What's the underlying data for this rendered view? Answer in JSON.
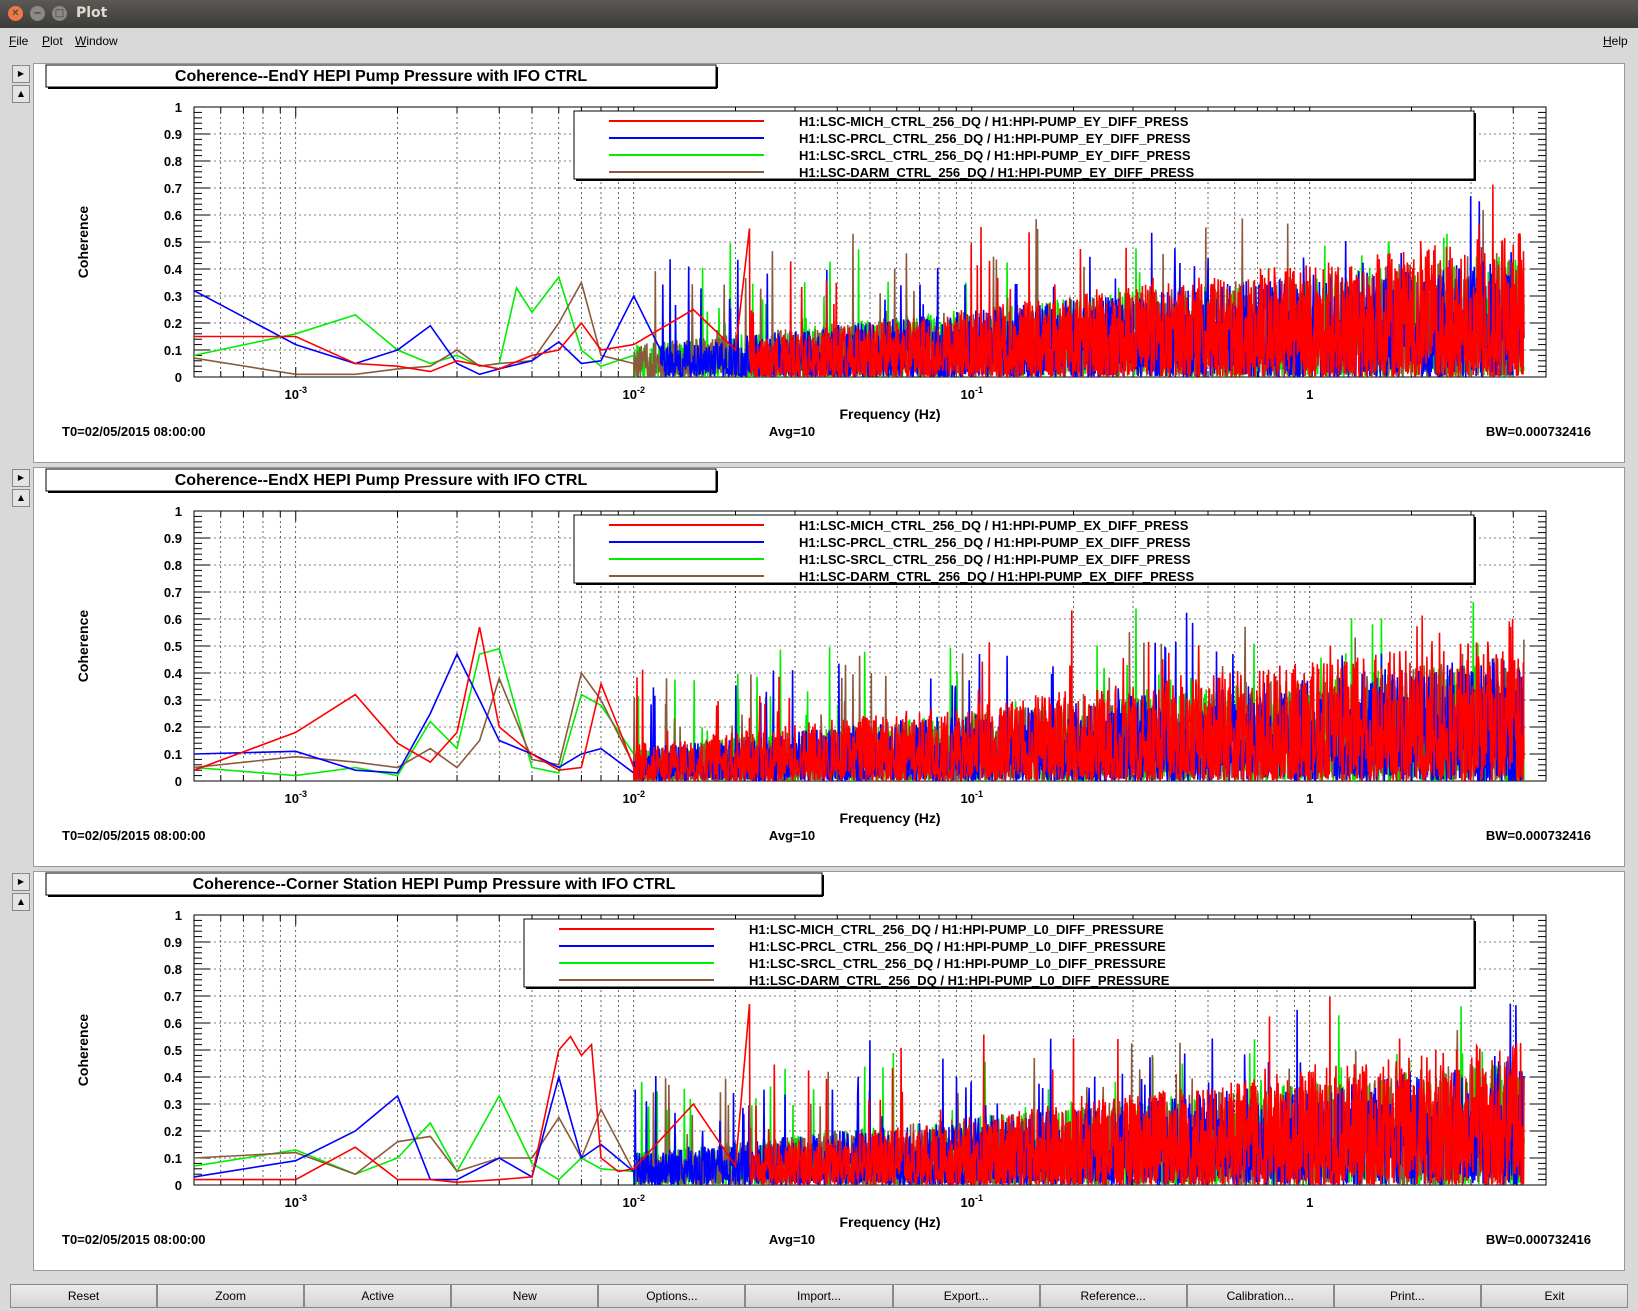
{
  "window": {
    "title": "Plot"
  },
  "menu": {
    "file": "File",
    "plot": "Plot",
    "window": "Window",
    "help": "Help"
  },
  "colors": {
    "red": "#ff0000",
    "blue": "#0000ff",
    "green": "#00ee00",
    "brown": "#8b5a3c"
  },
  "plots": [
    {
      "title": "Coherence--EndY HEPI Pump Pressure with IFO CTRL",
      "xlabel": "Frequency (Hz)",
      "ylabel": "Coherence",
      "t0": "T0=02/05/2015 08:00:00",
      "avg": "Avg=10",
      "bw": "BW=0.000732416",
      "legend": [
        "H1:LSC-MICH_CTRL_256_DQ / H1:HPI-PUMP_EY_DIFF_PRESS",
        "H1:LSC-PRCL_CTRL_256_DQ / H1:HPI-PUMP_EY_DIFF_PRESS",
        "H1:LSC-SRCL_CTRL_256_DQ / H1:HPI-PUMP_EY_DIFF_PRESS",
        "H1:LSC-DARM_CTRL_256_DQ / H1:HPI-PUMP_EY_DIFF_PRESS"
      ],
      "yticks": [
        "0",
        "0.1",
        "0.2",
        "0.3",
        "0.4",
        "0.5",
        "0.6",
        "0.7",
        "0.8",
        "0.9",
        "1"
      ],
      "xticks": [
        {
          "base": "10",
          "exp": "-3"
        },
        {
          "base": "10",
          "exp": "-2"
        },
        {
          "base": "10",
          "exp": "-1"
        },
        {
          "base": "1",
          "exp": ""
        }
      ]
    },
    {
      "title": "Coherence--EndX HEPI Pump Pressure with IFO CTRL",
      "xlabel": "Frequency (Hz)",
      "ylabel": "Coherence",
      "t0": "T0=02/05/2015 08:00:00",
      "avg": "Avg=10",
      "bw": "BW=0.000732416",
      "legend": [
        "H1:LSC-MICH_CTRL_256_DQ / H1:HPI-PUMP_EX_DIFF_PRESS",
        "H1:LSC-PRCL_CTRL_256_DQ / H1:HPI-PUMP_EX_DIFF_PRESS",
        "H1:LSC-SRCL_CTRL_256_DQ / H1:HPI-PUMP_EX_DIFF_PRESS",
        "H1:LSC-DARM_CTRL_256_DQ / H1:HPI-PUMP_EX_DIFF_PRESS"
      ],
      "yticks": [
        "0",
        "0.1",
        "0.2",
        "0.3",
        "0.4",
        "0.5",
        "0.6",
        "0.7",
        "0.8",
        "0.9",
        "1"
      ],
      "xticks": [
        {
          "base": "10",
          "exp": "-3"
        },
        {
          "base": "10",
          "exp": "-2"
        },
        {
          "base": "10",
          "exp": "-1"
        },
        {
          "base": "1",
          "exp": ""
        }
      ]
    },
    {
      "title": "Coherence--Corner Station HEPI Pump Pressure with IFO CTRL",
      "xlabel": "Frequency (Hz)",
      "ylabel": "Coherence",
      "t0": "T0=02/05/2015 08:00:00",
      "avg": "Avg=10",
      "bw": "BW=0.000732416",
      "legend": [
        "H1:LSC-MICH_CTRL_256_DQ / H1:HPI-PUMP_L0_DIFF_PRESSURE",
        "H1:LSC-PRCL_CTRL_256_DQ / H1:HPI-PUMP_L0_DIFF_PRESSURE",
        "H1:LSC-SRCL_CTRL_256_DQ / H1:HPI-PUMP_L0_DIFF_PRESSURE",
        "H1:LSC-DARM_CTRL_256_DQ / H1:HPI-PUMP_L0_DIFF_PRESSURE"
      ],
      "yticks": [
        "0",
        "0.1",
        "0.2",
        "0.3",
        "0.4",
        "0.5",
        "0.6",
        "0.7",
        "0.8",
        "0.9",
        "1"
      ],
      "xticks": [
        {
          "base": "10",
          "exp": "-3"
        },
        {
          "base": "10",
          "exp": "-2"
        },
        {
          "base": "10",
          "exp": "-1"
        },
        {
          "base": "1",
          "exp": ""
        }
      ]
    }
  ],
  "chart_data": [
    {
      "type": "line",
      "title": "Coherence--EndY HEPI Pump Pressure with IFO CTRL",
      "xlabel": "Frequency (Hz)",
      "ylabel": "Coherence",
      "xscale": "log",
      "xlim": [
        0.0005,
        5.0
      ],
      "ylim": [
        0,
        1
      ],
      "grid": true,
      "legend_position": "top-right",
      "series": [
        {
          "name": "H1:LSC-MICH_CTRL_256_DQ / H1:HPI-PUMP_EY_DIFF_PRESS",
          "color": "red",
          "x": [
            0.0005,
            0.001,
            0.0015,
            0.002,
            0.0025,
            0.003,
            0.004,
            0.005,
            0.006,
            0.007,
            0.008,
            0.01,
            0.015,
            0.02,
            0.022
          ],
          "y": [
            0.15,
            0.15,
            0.05,
            0.04,
            0.02,
            0.06,
            0.03,
            0.08,
            0.1,
            0.2,
            0.1,
            0.12,
            0.25,
            0.1,
            0.55
          ]
        },
        {
          "name": "H1:LSC-PRCL_CTRL_256_DQ / H1:HPI-PUMP_EY_DIFF_PRESS",
          "color": "blue",
          "x": [
            0.0005,
            0.001,
            0.0015,
            0.002,
            0.0025,
            0.003,
            0.0035,
            0.004,
            0.005,
            0.006,
            0.007,
            0.008,
            0.01,
            0.012
          ],
          "y": [
            0.32,
            0.12,
            0.05,
            0.1,
            0.19,
            0.05,
            0.01,
            0.03,
            0.06,
            0.13,
            0.05,
            0.06,
            0.3,
            0.1
          ]
        },
        {
          "name": "H1:LSC-SRCL_CTRL_256_DQ / H1:HPI-PUMP_EY_DIFF_PRESS",
          "color": "green",
          "x": [
            0.0005,
            0.001,
            0.0015,
            0.002,
            0.0025,
            0.003,
            0.0035,
            0.004,
            0.0045,
            0.005,
            0.006,
            0.007,
            0.008,
            0.01
          ],
          "y": [
            0.08,
            0.16,
            0.23,
            0.1,
            0.05,
            0.08,
            0.04,
            0.05,
            0.33,
            0.24,
            0.37,
            0.1,
            0.04,
            0.08
          ]
        },
        {
          "name": "H1:LSC-DARM_CTRL_256_DQ / H1:HPI-PUMP_EY_DIFF_PRESS",
          "color": "brown",
          "x": [
            0.0005,
            0.001,
            0.0015,
            0.002,
            0.0025,
            0.003,
            0.0035,
            0.004,
            0.005,
            0.006,
            0.007,
            0.008,
            0.01
          ],
          "y": [
            0.07,
            0.01,
            0.01,
            0.03,
            0.04,
            0.1,
            0.04,
            0.05,
            0.06,
            0.2,
            0.35,
            0.08,
            0.05
          ]
        }
      ]
    },
    {
      "type": "line",
      "title": "Coherence--EndX HEPI Pump Pressure with IFO CTRL",
      "xlabel": "Frequency (Hz)",
      "ylabel": "Coherence",
      "xscale": "log",
      "xlim": [
        0.0005,
        5.0
      ],
      "ylim": [
        0,
        1
      ],
      "grid": true,
      "legend_position": "top-right",
      "series": [
        {
          "name": "H1:LSC-MICH_CTRL_256_DQ / H1:HPI-PUMP_EX_DIFF_PRESS",
          "color": "red",
          "x": [
            0.0005,
            0.001,
            0.0015,
            0.002,
            0.0025,
            0.003,
            0.0035,
            0.004,
            0.005,
            0.006,
            0.007,
            0.008,
            0.009,
            0.01
          ],
          "y": [
            0.04,
            0.18,
            0.32,
            0.14,
            0.07,
            0.18,
            0.57,
            0.2,
            0.1,
            0.04,
            0.05,
            0.36,
            0.2,
            0.05
          ]
        },
        {
          "name": "H1:LSC-PRCL_CTRL_256_DQ / H1:HPI-PUMP_EX_DIFF_PRESS",
          "color": "blue",
          "x": [
            0.0005,
            0.001,
            0.0015,
            0.002,
            0.0025,
            0.003,
            0.0035,
            0.004,
            0.005,
            0.006,
            0.007,
            0.008,
            0.01
          ],
          "y": [
            0.1,
            0.11,
            0.04,
            0.03,
            0.25,
            0.47,
            0.3,
            0.15,
            0.1,
            0.05,
            0.1,
            0.12,
            0.03
          ]
        },
        {
          "name": "H1:LSC-SRCL_CTRL_256_DQ / H1:HPI-PUMP_EX_DIFF_PRESS",
          "color": "green",
          "x": [
            0.0005,
            0.001,
            0.0015,
            0.002,
            0.0025,
            0.003,
            0.0035,
            0.004,
            0.005,
            0.006,
            0.007,
            0.008,
            0.01
          ],
          "y": [
            0.05,
            0.02,
            0.05,
            0.02,
            0.22,
            0.12,
            0.47,
            0.49,
            0.05,
            0.03,
            0.32,
            0.28,
            0.1
          ]
        },
        {
          "name": "H1:LSC-DARM_CTRL_256_DQ / H1:HPI-PUMP_EX_DIFF_PRESS",
          "color": "brown",
          "x": [
            0.0005,
            0.001,
            0.0015,
            0.002,
            0.0025,
            0.003,
            0.0035,
            0.004,
            0.005,
            0.006,
            0.007,
            0.008,
            0.01
          ],
          "y": [
            0.05,
            0.09,
            0.07,
            0.05,
            0.12,
            0.05,
            0.15,
            0.38,
            0.08,
            0.06,
            0.4,
            0.3,
            0.06
          ]
        }
      ]
    },
    {
      "type": "line",
      "title": "Coherence--Corner Station HEPI Pump Pressure with IFO CTRL",
      "xlabel": "Frequency (Hz)",
      "ylabel": "Coherence",
      "xscale": "log",
      "xlim": [
        0.0005,
        5.0
      ],
      "ylim": [
        0,
        1
      ],
      "grid": true,
      "legend_position": "top-right",
      "series": [
        {
          "name": "H1:LSC-MICH_CTRL_256_DQ / H1:HPI-PUMP_L0_DIFF_PRESSURE",
          "color": "red",
          "x": [
            0.0005,
            0.001,
            0.0015,
            0.002,
            0.0025,
            0.003,
            0.004,
            0.005,
            0.006,
            0.0065,
            0.007,
            0.0075,
            0.008,
            0.009,
            0.01,
            0.015,
            0.02,
            0.022
          ],
          "y": [
            0.02,
            0.02,
            0.14,
            0.02,
            0.02,
            0.01,
            0.02,
            0.03,
            0.5,
            0.55,
            0.48,
            0.52,
            0.1,
            0.05,
            0.06,
            0.3,
            0.07,
            0.67
          ]
        },
        {
          "name": "H1:LSC-PRCL_CTRL_256_DQ / H1:HPI-PUMP_L0_DIFF_PRESSURE",
          "color": "blue",
          "x": [
            0.0005,
            0.001,
            0.0015,
            0.002,
            0.0025,
            0.003,
            0.004,
            0.005,
            0.006,
            0.007,
            0.008,
            0.01
          ],
          "y": [
            0.03,
            0.09,
            0.2,
            0.33,
            0.02,
            0.02,
            0.1,
            0.03,
            0.4,
            0.1,
            0.15,
            0.05
          ]
        },
        {
          "name": "H1:LSC-SRCL_CTRL_256_DQ / H1:HPI-PUMP_L0_DIFF_PRESSURE",
          "color": "green",
          "x": [
            0.0005,
            0.001,
            0.0015,
            0.002,
            0.0025,
            0.003,
            0.004,
            0.005,
            0.006,
            0.007,
            0.008,
            0.01
          ],
          "y": [
            0.07,
            0.13,
            0.04,
            0.1,
            0.23,
            0.05,
            0.33,
            0.08,
            0.02,
            0.1,
            0.06,
            0.05
          ]
        },
        {
          "name": "H1:LSC-DARM_CTRL_256_DQ / H1:HPI-PUMP_L0_DIFF_PRESSURE",
          "color": "brown",
          "x": [
            0.0005,
            0.001,
            0.0015,
            0.002,
            0.0025,
            0.003,
            0.004,
            0.005,
            0.006,
            0.007,
            0.008,
            0.01
          ],
          "y": [
            0.1,
            0.12,
            0.04,
            0.16,
            0.18,
            0.05,
            0.1,
            0.1,
            0.25,
            0.1,
            0.28,
            0.05
          ]
        }
      ]
    }
  ],
  "buttons": [
    "Reset",
    "Zoom",
    "Active",
    "New",
    "Options...",
    "Import...",
    "Export...",
    "Reference...",
    "Calibration...",
    "Print...",
    "Exit"
  ]
}
